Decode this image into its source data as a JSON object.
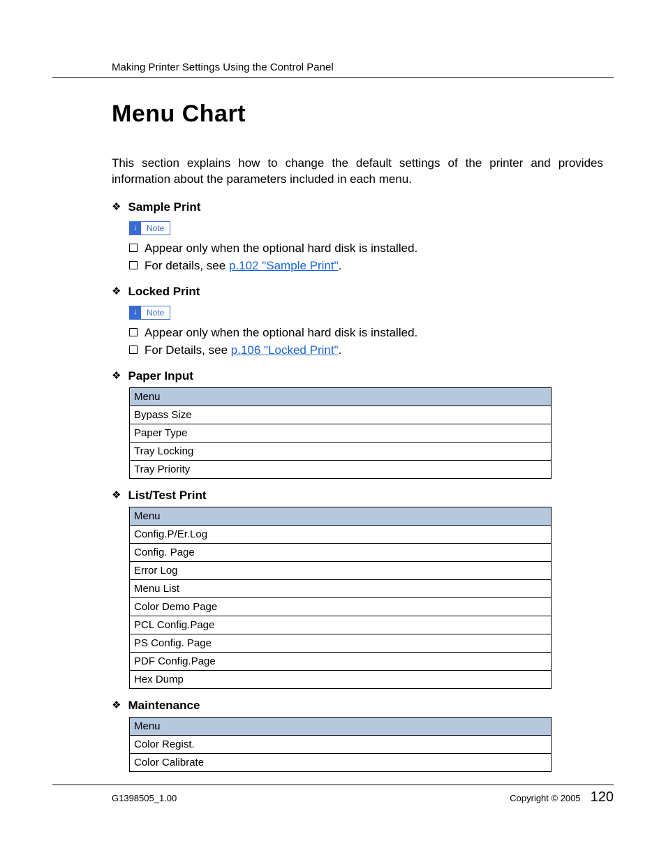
{
  "header": {
    "running_head": "Making Printer Settings Using the Control Panel"
  },
  "title": "Menu Chart",
  "intro": "This section explains how to change the default settings of the printer and provides information about the parameters included in each menu.",
  "note_label": "Note",
  "sections": {
    "sample_print": {
      "title": "Sample Print",
      "line1": "Appear only when the optional hard disk is installed.",
      "line2_pre": "For details, see ",
      "line2_link": "p.102 \"Sample Print\"",
      "line2_post": "."
    },
    "locked_print": {
      "title": "Locked Print",
      "line1": "Appear only when the optional hard disk is installed.",
      "line2_pre": "For Details, see ",
      "line2_link": "p.106 \"Locked Print\"",
      "line2_post": "."
    },
    "paper_input": {
      "title": "Paper Input",
      "table_header": "Menu",
      "rows": [
        "Bypass Size",
        "Paper Type",
        "Tray Locking",
        "Tray Priority"
      ]
    },
    "list_test": {
      "title": "List/Test Print",
      "table_header": "Menu",
      "rows": [
        "Config.P/Er.Log",
        "Config. Page",
        "Error Log",
        "Menu List",
        "Color Demo Page",
        "PCL Config.Page",
        "PS Config. Page",
        "PDF Config.Page",
        "Hex Dump"
      ]
    },
    "maintenance": {
      "title": "Maintenance",
      "table_header": "Menu",
      "rows": [
        "Color Regist.",
        "Color Calibrate"
      ]
    }
  },
  "footer": {
    "doc_id": "G1398505_1.00",
    "copyright": "Copyright © 2005",
    "page": "120"
  }
}
